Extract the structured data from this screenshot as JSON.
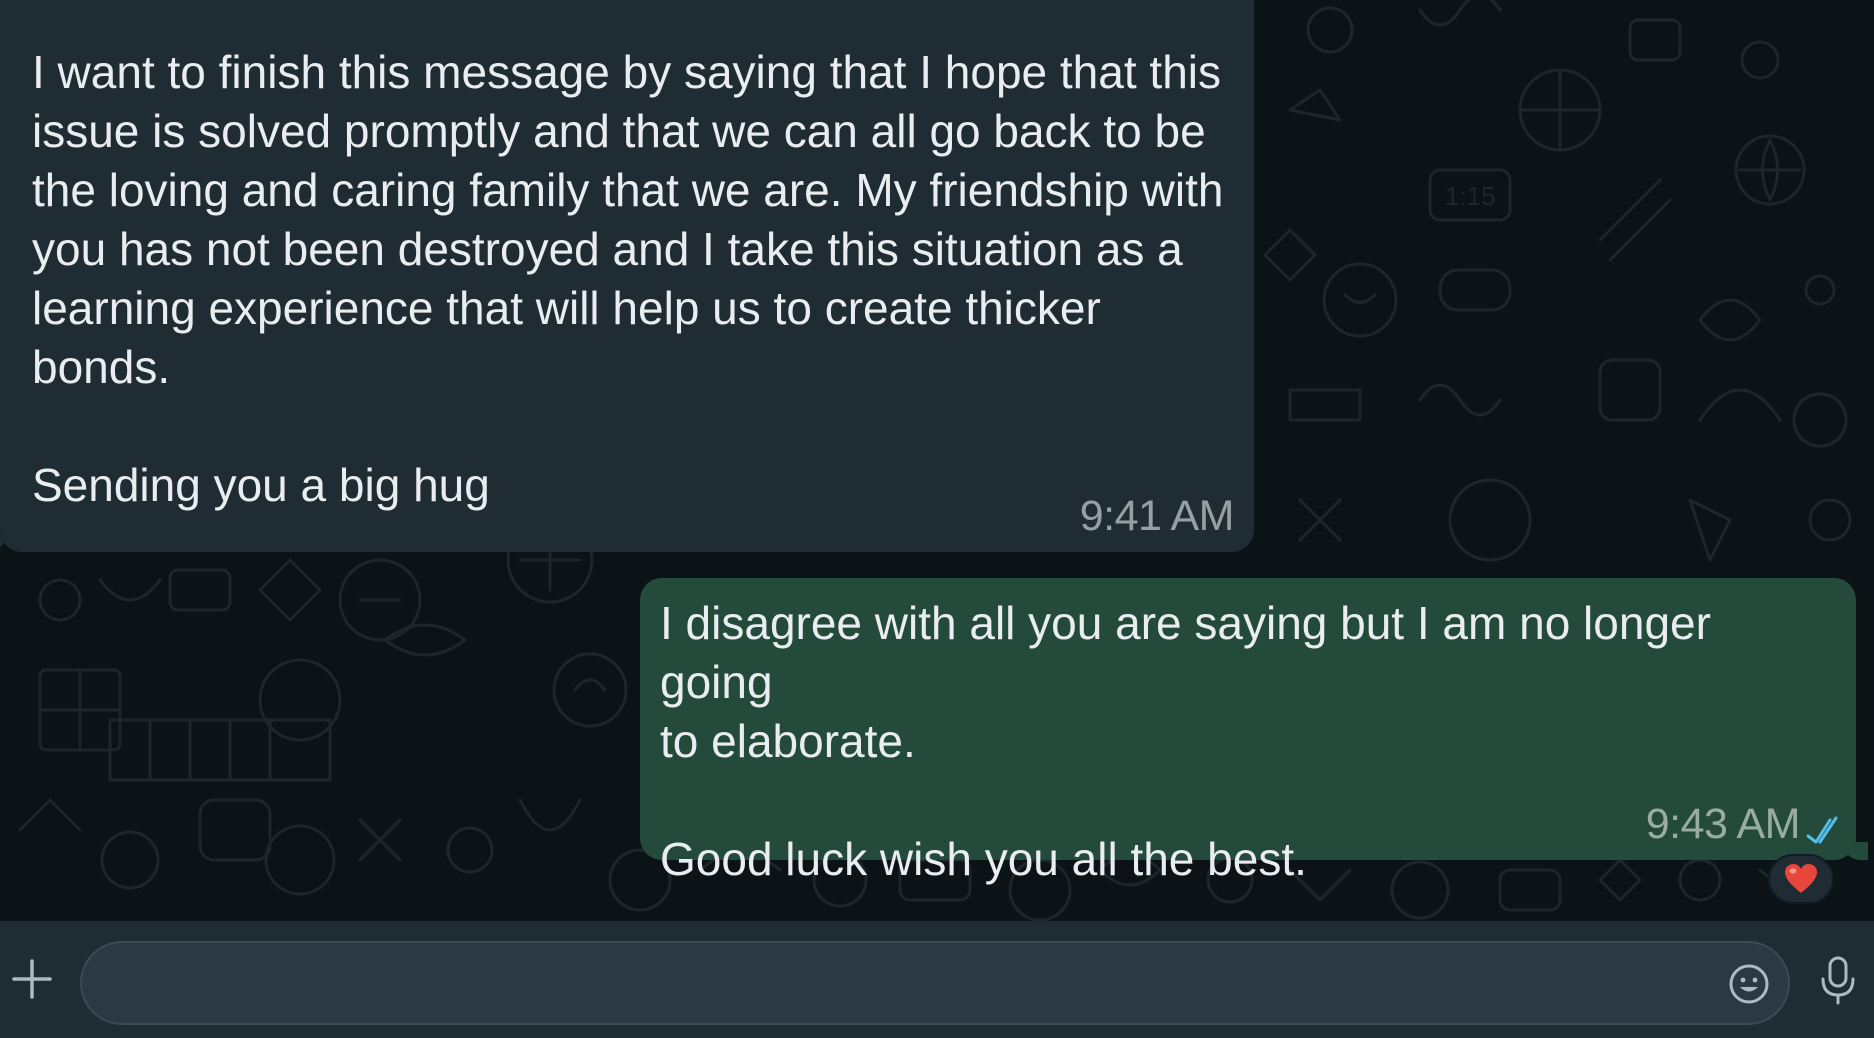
{
  "messages": [
    {
      "direction": "incoming",
      "text": "I want to finish this message by saying that I hope that this\nissue is solved promptly and that we can all go back to be\nthe loving and caring family that we are. My friendship with\nyou has not been destroyed and I take this situation as a\nlearning experience that will help us to create thicker\nbonds.\n\nSending you a big hug",
      "time": "9:41 AM"
    },
    {
      "direction": "outgoing",
      "text": "I disagree with all you are saying but I am no longer going\nto elaborate.\n\nGood luck wish you all the best.",
      "time": "9:43 AM",
      "status_icon": "double-check-icon",
      "status_color": "#53bdeb",
      "reaction": "heart-emoji"
    }
  ],
  "input_bar": {
    "message_value": "",
    "placeholder": "",
    "left_icon": "plus-icon",
    "emoji_icon": "smiley-icon",
    "right_icon": "microphone-icon"
  },
  "colors": {
    "chat_background": "#0c1317",
    "incoming_bubble": "#202c33",
    "outgoing_bubble": "#234a3a",
    "input_bar": "#1f2c33",
    "reaction_heart": "#e8463a"
  }
}
